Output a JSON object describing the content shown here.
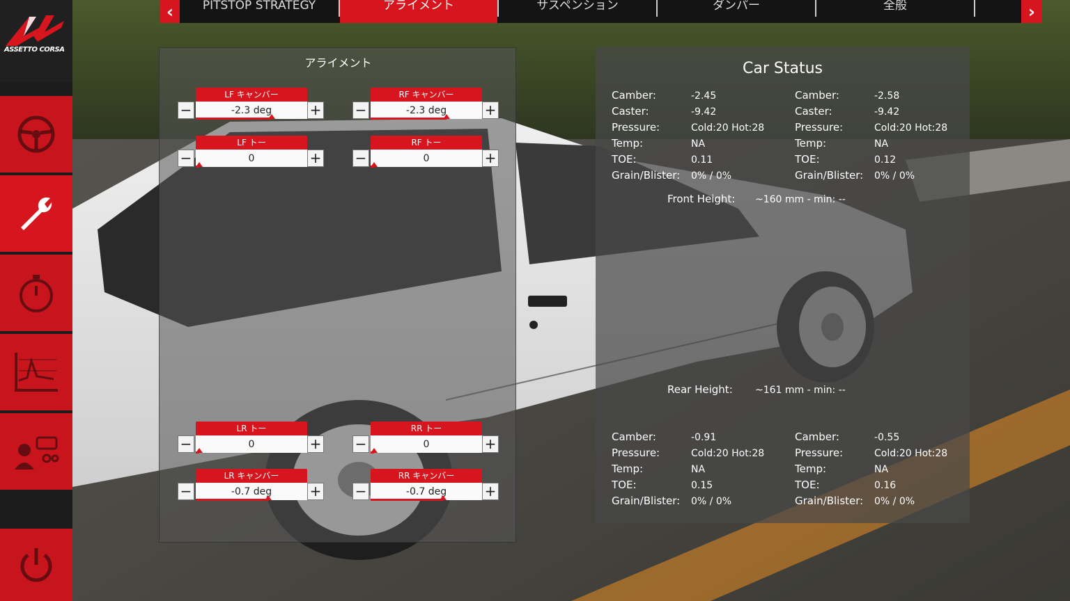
{
  "brand": {
    "logo_text": "ASSETTO CORSA"
  },
  "colors": {
    "accent": "#d6151e",
    "panel": "#555555",
    "sidebar": "#1c1c1c"
  },
  "sidebar": {
    "items": [
      {
        "icon": "steering-wheel-icon"
      },
      {
        "icon": "wrench-icon",
        "active": true
      },
      {
        "icon": "stopwatch-icon"
      },
      {
        "icon": "chart-icon"
      },
      {
        "icon": "driver-settings-icon"
      },
      {
        "icon": "power-icon"
      }
    ]
  },
  "tabs": {
    "prev_arrow": "‹",
    "next_arrow": "›",
    "items": [
      {
        "label": "PITSTOP STRATEGY"
      },
      {
        "label": "アライメント",
        "active": true
      },
      {
        "label": "サスペンション"
      },
      {
        "label": "ダンパー"
      },
      {
        "label": "全般"
      }
    ]
  },
  "alignment": {
    "title": "アライメント",
    "minus": "−",
    "plus": "+",
    "controls": {
      "lf_camber": {
        "label": "LF キャンバー",
        "value": "-2.3 deg",
        "level": 0.68
      },
      "rf_camber": {
        "label": "RF キャンバー",
        "value": "-2.3 deg",
        "level": 0.68
      },
      "lf_toe": {
        "label": "LF トー",
        "value": "0",
        "level": 0.03
      },
      "rf_toe": {
        "label": "RF トー",
        "value": "0",
        "level": 0.03
      },
      "lr_toe": {
        "label": "LR トー",
        "value": "0",
        "level": 0.03
      },
      "rr_toe": {
        "label": "RR トー",
        "value": "0",
        "level": 0.03
      },
      "lr_camber": {
        "label": "LR キャンバー",
        "value": "-0.7 deg",
        "level": 0.65
      },
      "rr_camber": {
        "label": "RR キャンバー",
        "value": "-0.7 deg",
        "level": 0.65
      }
    }
  },
  "status": {
    "title": "Car Status",
    "front_left": {
      "camber": "-2.45",
      "caster": "-9.42",
      "pressure": "Cold:20 Hot:28",
      "temp": "NA",
      "toe": "0.11",
      "grain": "0% / 0%"
    },
    "front_right": {
      "camber": "-2.58",
      "caster": "-9.42",
      "pressure": "Cold:20 Hot:28",
      "temp": "NA",
      "toe": "0.12",
      "grain": "0% / 0%"
    },
    "rear_left": {
      "camber": "-0.91",
      "pressure": "Cold:20 Hot:28",
      "temp": "NA",
      "toe": "0.15",
      "grain": "0% / 0%"
    },
    "rear_right": {
      "camber": "-0.55",
      "pressure": "Cold:20 Hot:28",
      "temp": "NA",
      "toe": "0.16",
      "grain": "0% / 0%"
    },
    "labels": {
      "camber": "Camber:",
      "caster": "Caster:",
      "pressure": "Pressure:",
      "temp": "Temp:",
      "toe": "TOE:",
      "grain": "Grain/Blister:"
    },
    "front_height": {
      "label": "Front Height:",
      "value": "~160 mm - min: --"
    },
    "rear_height": {
      "label": "Rear Height:",
      "value": "~161 mm - min: --"
    }
  }
}
